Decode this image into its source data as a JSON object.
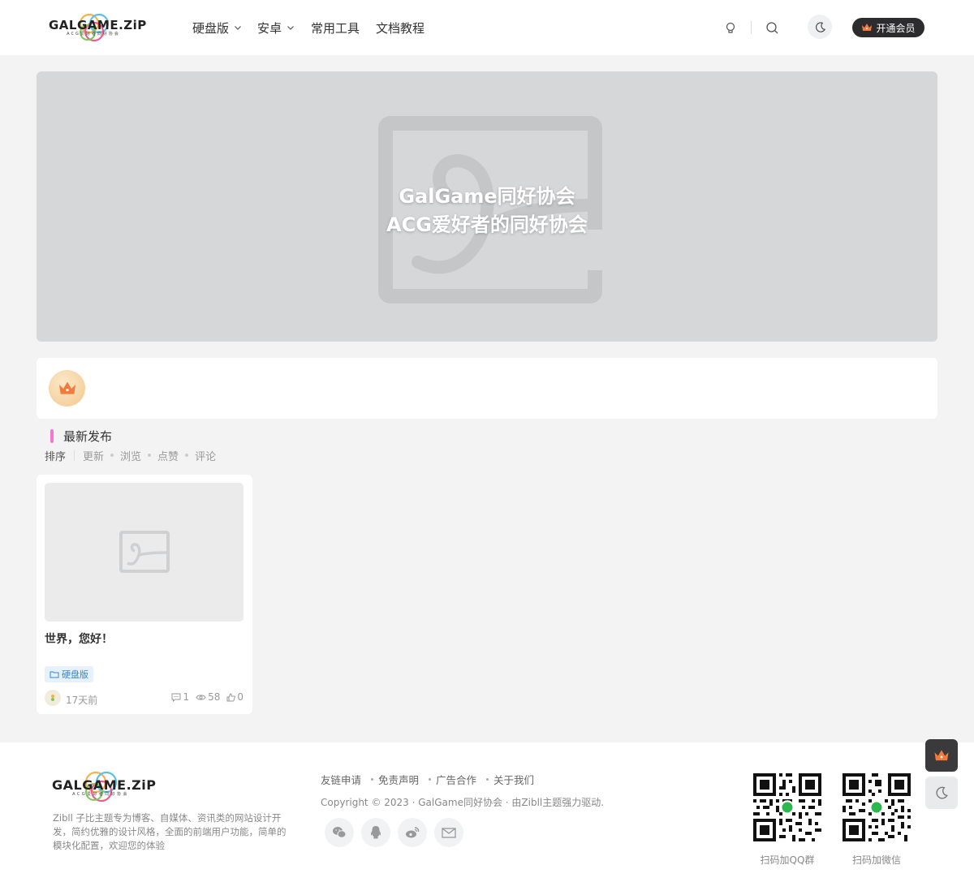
{
  "brand": {
    "wordmark": "GALGAME.ZiP",
    "tagline": "ACG爱好者同好协会"
  },
  "nav": {
    "items": [
      {
        "label": "硬盘版",
        "has_dropdown": true
      },
      {
        "label": "安卓",
        "has_dropdown": true
      },
      {
        "label": "常用工具",
        "has_dropdown": false
      },
      {
        "label": "文档教程",
        "has_dropdown": false
      }
    ]
  },
  "header": {
    "vip_label": "开通会员",
    "icons": [
      "hint-icon",
      "search-icon",
      "moon-icon"
    ]
  },
  "banner": {
    "title_line1": "GalGame同好协会",
    "title_line2": "ACG爱好者的同好协会"
  },
  "section": {
    "title": "最新发布",
    "sort_label": "排序",
    "sort_options": [
      "更新",
      "浏览",
      "点赞",
      "评论"
    ]
  },
  "post": {
    "title": "世界，您好！",
    "category": "硬盘版",
    "time": "17天前",
    "comments": "1",
    "views": "58",
    "likes": "0"
  },
  "footer": {
    "description": "Zibll 子比主题专为博客、自媒体、资讯类的网站设计开发，简约优雅的设计风格，全面的前端用户功能，简单的模块化配置，欢迎您的体验",
    "links": [
      "友链申请",
      "免责声明",
      "广告合作",
      "关于我们"
    ],
    "copyright": "Copyright © 2023 · GalGame同好协会 · 由Zibll主题强力驱动.",
    "social": [
      "wechat-icon",
      "qq-icon",
      "weibo-icon",
      "mail-icon"
    ],
    "qr_captions": [
      "扫码加QQ群",
      "扫码加微信"
    ]
  },
  "colors": {
    "accent": "#f278d0",
    "vip_bg": "#2c2c2e",
    "crown": "#f5793b",
    "tag_bg": "#e6f1fc",
    "tag_text": "#2a8ae0"
  }
}
